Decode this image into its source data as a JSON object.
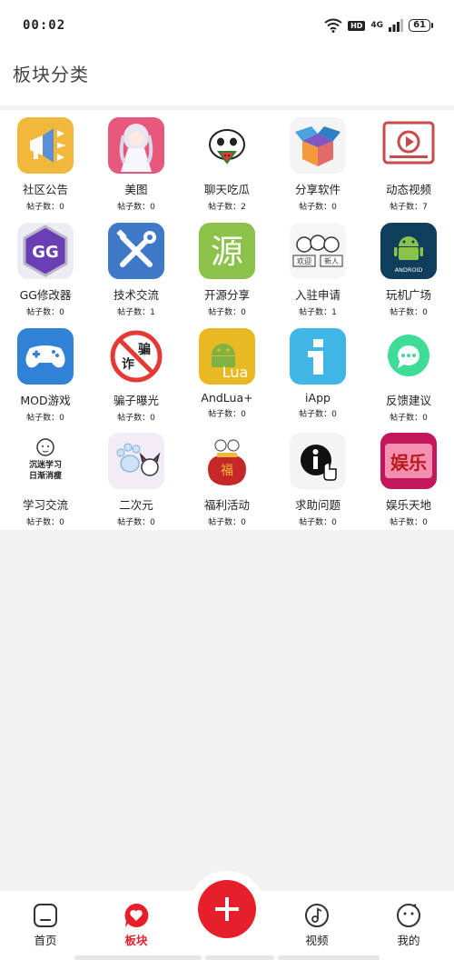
{
  "status_bar": {
    "time": "00:02",
    "hd": "HD",
    "network": "4G",
    "battery": "61"
  },
  "header": {
    "title": "板块分类"
  },
  "count_prefix": "帖子数：",
  "boards": [
    {
      "name": "社区公告",
      "count": "0",
      "icon": "megaphone-icon"
    },
    {
      "name": "美图",
      "count": "0",
      "icon": "anime-girl-icon"
    },
    {
      "name": "聊天吃瓜",
      "count": "2",
      "icon": "watermelon-face-icon"
    },
    {
      "name": "分享软件",
      "count": "0",
      "icon": "open-box-icon"
    },
    {
      "name": "动态视频",
      "count": "7",
      "icon": "video-player-icon"
    },
    {
      "name": "GG修改器",
      "count": "0",
      "icon": "gg-icon"
    },
    {
      "name": "技术交流",
      "count": "1",
      "icon": "tools-icon"
    },
    {
      "name": "开源分享",
      "count": "0",
      "icon": "source-icon",
      "glyph": "源"
    },
    {
      "name": "入驻申请",
      "count": "1",
      "icon": "cats-welcome-icon",
      "badge1": "欢迎",
      "badge2": "新人"
    },
    {
      "name": "玩机广场",
      "count": "0",
      "icon": "android-icon",
      "caption": "ANDROID"
    },
    {
      "name": "MOD游戏",
      "count": "0",
      "icon": "gamepad-icon"
    },
    {
      "name": "骗子曝光",
      "count": "0",
      "icon": "no-scam-icon",
      "glyph1": "骗",
      "glyph2": "诈"
    },
    {
      "name": "AndLua+",
      "count": "0",
      "icon": "lua-icon",
      "caption": "Lua"
    },
    {
      "name": "iApp",
      "count": "0",
      "icon": "iapp-icon"
    },
    {
      "name": "反馈建议",
      "count": "0",
      "icon": "chat-bubble-icon"
    },
    {
      "name": "学习交流",
      "count": "0",
      "icon": "study-icon",
      "line1": "沉迷学习",
      "line2": "日渐消瘦"
    },
    {
      "name": "二次元",
      "count": "0",
      "icon": "paw-icon"
    },
    {
      "name": "福利活动",
      "count": "0",
      "icon": "lucky-bag-icon",
      "glyph": "福"
    },
    {
      "name": "求助问题",
      "count": "0",
      "icon": "info-hand-icon"
    },
    {
      "name": "娱乐天地",
      "count": "0",
      "icon": "entertainment-icon",
      "glyph": "娱乐"
    }
  ],
  "nav": {
    "home": "首页",
    "boards": "板块",
    "video": "视频",
    "mine": "我的"
  },
  "colors": {
    "accent": "#e5202a"
  }
}
